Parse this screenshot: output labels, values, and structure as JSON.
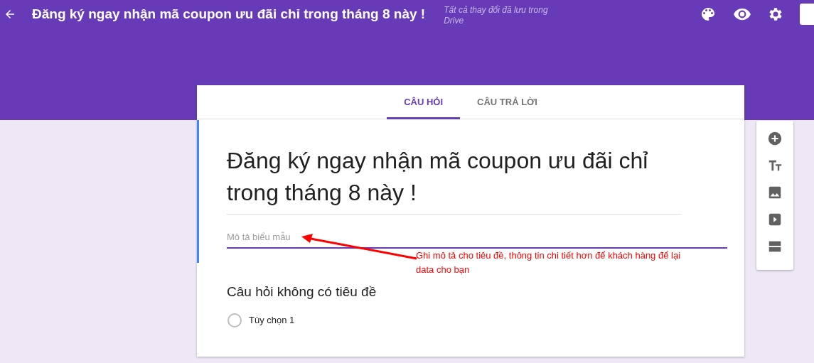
{
  "header": {
    "title": "Đăng ký ngay nhận mã coupon ưu đãi chỉ trong tháng 8 này !",
    "save_status": "Tất cả thay đổi đã lưu trong Drive"
  },
  "tabs": [
    {
      "label": "CÂU HỎI",
      "selected": true
    },
    {
      "label": "CÂU TRẢ LỜI",
      "selected": false
    }
  ],
  "form": {
    "title": "Đăng ký ngay nhận mã coupon ưu đãi chỉ trong tháng 8 này !",
    "description": {
      "placeholder": "Mô tả biểu mẫu"
    }
  },
  "question": {
    "title": "Câu hỏi không có tiêu đề",
    "options": [
      {
        "label": "Tùy chọn 1",
        "selected": false
      }
    ]
  },
  "annotation": {
    "text": "Ghi mô tả cho tiêu đề, thông tin chi tiết hơn để khách hàng để lại data cho bạn"
  }
}
